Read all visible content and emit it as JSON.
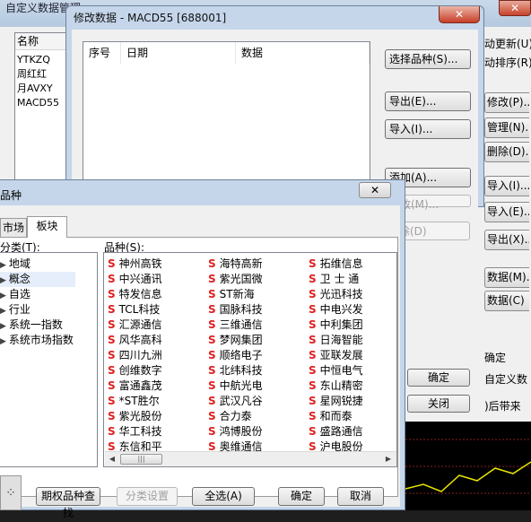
{
  "bg_window": {
    "title": "自定义数据管理",
    "close_label": "✕",
    "list_header": "名称",
    "list_items": [
      "YTKZQ",
      "周红红",
      "月AVXY",
      "MACD55"
    ],
    "right_texts": [
      "动更新(U)",
      "动排序(R)"
    ],
    "right_buttons": [
      "修改(P)...",
      "管理(N)...",
      "删除(D)...",
      "导入(I)...",
      "导入(E)...",
      "导出(X)...",
      "数据(M)...",
      "数据(C)"
    ],
    "confirm_text": "确定",
    "custom_text": "自定义数",
    "after_text": ")后带来"
  },
  "edit_dialog": {
    "title": "修改数据 - MACD55 [688001]",
    "close_label": "✕",
    "columns": [
      "序号",
      "日期",
      "数据"
    ],
    "buttons": {
      "select_variety": "选择品种(S)...",
      "export": "导出(E)...",
      "import": "导入(I)...",
      "add": "添加(A)...",
      "modify": "修改(M)...",
      "delete": "删除(D)"
    },
    "ok": "确定",
    "close": "关闭"
  },
  "pick_dialog": {
    "title": "品种",
    "close_label": "✕",
    "tabs": [
      "市场",
      "板块"
    ],
    "category_label": "分类(T):",
    "category_items": [
      "地域",
      "概念",
      "自选",
      "行业",
      "系统一指数",
      "系统市场指数"
    ],
    "selected_category": "概念",
    "variety_label": "品种(S):",
    "stock_mark": "S",
    "stock_columns": [
      [
        "神州高铁",
        "中兴通讯",
        "特发信息",
        "TCL科技",
        "汇源通信",
        "风华高科",
        "四川九洲",
        "创维数字",
        "富通鑫茂",
        "*ST胜尔",
        "紫光股份",
        "华工科技",
        "东信和平"
      ],
      [
        "海特高新",
        "紫光国微",
        "ST新海",
        "国脉科技",
        "三维通信",
        "梦网集团",
        "顺络电子",
        "北纬科技",
        "中航光电",
        "武汉凡谷",
        "合力泰",
        "鸿博股份",
        "奥维通信"
      ],
      [
        "拓维信息",
        "卫 士 通",
        "光迅科技",
        "中电兴发",
        "中利集团",
        "日海智能",
        "亚联发展",
        "中恒电气",
        "东山精密",
        "星网锐捷",
        "和而泰",
        "盛路通信",
        "沪电股份"
      ]
    ],
    "scroll_thumb": "|||",
    "buttons": {
      "search": "期权品种查找",
      "classify": "分类设置",
      "select_all": "全选(A)",
      "ok": "确定",
      "cancel": "取消"
    }
  }
}
